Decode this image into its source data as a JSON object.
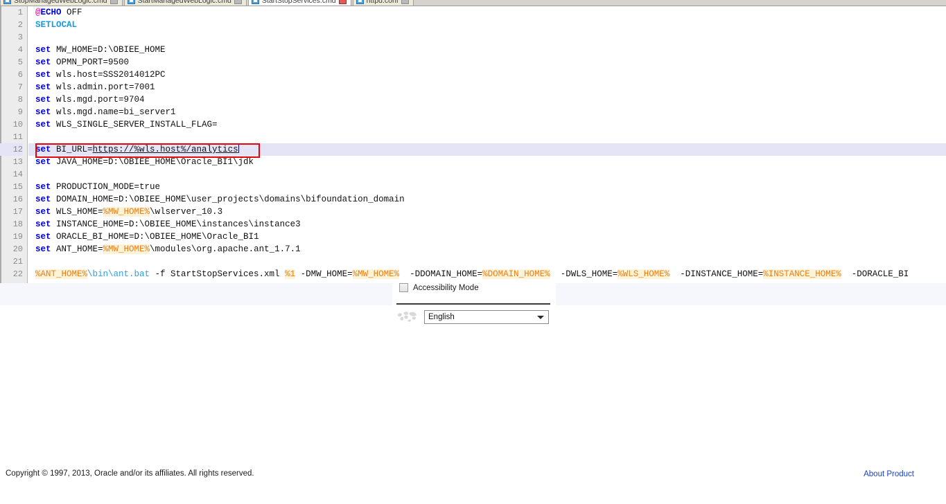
{
  "tabs": [
    {
      "label": "StopManagedWebLogic.cmd",
      "active": false
    },
    {
      "label": "StartManagedWebLogic.cmd",
      "active": false
    },
    {
      "label": "StartStopServices.cmd",
      "active": true
    },
    {
      "label": "httpd.conf",
      "active": false
    }
  ],
  "editor": {
    "highlighted_line": 12,
    "annotation_color": "#e8000a",
    "lines": [
      {
        "n": 1,
        "tokens": [
          {
            "t": "@",
            "c": "at"
          },
          {
            "t": "ECHO",
            "c": "kw"
          },
          {
            "t": " OFF",
            "c": ""
          }
        ]
      },
      {
        "n": 2,
        "tokens": [
          {
            "t": "SETLOCAL",
            "c": "kw2"
          }
        ]
      },
      {
        "n": 3,
        "tokens": []
      },
      {
        "n": 4,
        "tokens": [
          {
            "t": "set",
            "c": "kw"
          },
          {
            "t": " MW_HOME=D:\\OBIEE_HOME",
            "c": ""
          }
        ]
      },
      {
        "n": 5,
        "tokens": [
          {
            "t": "set",
            "c": "kw"
          },
          {
            "t": " OPMN_PORT=9500",
            "c": ""
          }
        ]
      },
      {
        "n": 6,
        "tokens": [
          {
            "t": "set",
            "c": "kw"
          },
          {
            "t": " wls.host=SSS2014012PC",
            "c": ""
          }
        ]
      },
      {
        "n": 7,
        "tokens": [
          {
            "t": "set",
            "c": "kw"
          },
          {
            "t": " wls.admin.port=7001",
            "c": ""
          }
        ]
      },
      {
        "n": 8,
        "tokens": [
          {
            "t": "set",
            "c": "kw"
          },
          {
            "t": " wls.mgd.port=9704",
            "c": ""
          }
        ]
      },
      {
        "n": 9,
        "tokens": [
          {
            "t": "set",
            "c": "kw"
          },
          {
            "t": " wls.mgd.name=bi_server1",
            "c": ""
          }
        ]
      },
      {
        "n": 10,
        "tokens": [
          {
            "t": "set",
            "c": "kw"
          },
          {
            "t": " WLS_SINGLE_SERVER_INSTALL_FLAG=",
            "c": ""
          }
        ]
      },
      {
        "n": 11,
        "tokens": []
      },
      {
        "n": 12,
        "tokens": [
          {
            "t": "set",
            "c": "kw"
          },
          {
            "t": " BI_URL=",
            "c": ""
          },
          {
            "t": "https://%wls.host%/analytics",
            "c": "url"
          },
          {
            "t": "",
            "c": "cursor"
          }
        ]
      },
      {
        "n": 13,
        "tokens": [
          {
            "t": "set",
            "c": "kw"
          },
          {
            "t": " JAVA_HOME=D:\\OBIEE_HOME\\Oracle_BI1\\jdk",
            "c": ""
          }
        ]
      },
      {
        "n": 14,
        "tokens": []
      },
      {
        "n": 15,
        "tokens": [
          {
            "t": "set",
            "c": "kw"
          },
          {
            "t": " PRODUCTION_MODE=true",
            "c": ""
          }
        ]
      },
      {
        "n": 16,
        "tokens": [
          {
            "t": "set",
            "c": "kw"
          },
          {
            "t": " DOMAIN_HOME=D:\\OBIEE_HOME\\user_projects\\domains\\bifoundation_domain",
            "c": ""
          }
        ]
      },
      {
        "n": 17,
        "tokens": [
          {
            "t": "set",
            "c": "kw"
          },
          {
            "t": " WLS_HOME=",
            "c": ""
          },
          {
            "t": "%MW_HOME%",
            "c": "var"
          },
          {
            "t": "\\wlserver_10.3",
            "c": ""
          }
        ]
      },
      {
        "n": 18,
        "tokens": [
          {
            "t": "set",
            "c": "kw"
          },
          {
            "t": " INSTANCE_HOME=D:\\OBIEE_HOME\\instances\\instance3",
            "c": ""
          }
        ]
      },
      {
        "n": 19,
        "tokens": [
          {
            "t": "set",
            "c": "kw"
          },
          {
            "t": " ORACLE_BI_HOME=D:\\OBIEE_HOME\\Oracle_BI1",
            "c": ""
          }
        ]
      },
      {
        "n": 20,
        "tokens": [
          {
            "t": "set",
            "c": "kw"
          },
          {
            "t": " ANT_HOME=",
            "c": ""
          },
          {
            "t": "%MW_HOME%",
            "c": "var"
          },
          {
            "t": "\\modules\\org.apache.ant_1.7.1",
            "c": ""
          }
        ]
      },
      {
        "n": 21,
        "tokens": []
      },
      {
        "n": 22,
        "tokens": [
          {
            "t": "%ANT_HOME%",
            "c": "var"
          },
          {
            "t": "\\bin\\ant.bat",
            "c": "path"
          },
          {
            "t": " -f StartStopServices.xml ",
            "c": ""
          },
          {
            "t": "%1",
            "c": "var"
          },
          {
            "t": " -DMW_HOME=",
            "c": ""
          },
          {
            "t": "%MW_HOME%",
            "c": "var"
          },
          {
            "t": "  -DDOMAIN_HOME=",
            "c": ""
          },
          {
            "t": "%DOMAIN_HOME%",
            "c": "var"
          },
          {
            "t": "  -DWLS_HOME=",
            "c": ""
          },
          {
            "t": "%WLS_HOME%",
            "c": "var"
          },
          {
            "t": "  -DINSTANCE_HOME=",
            "c": ""
          },
          {
            "t": "%INSTANCE_HOME%",
            "c": "var"
          },
          {
            "t": "  -DORACLE_BI",
            "c": ""
          }
        ]
      }
    ]
  },
  "accessibility": {
    "checkbox_label": "Accessibility Mode",
    "checked": false
  },
  "language": {
    "icon": "globe-icon",
    "selected": "English",
    "options": [
      "English"
    ]
  },
  "footer": {
    "copyright": "Copyright © 1997, 2013, Oracle and/or its affiliates. All rights reserved.",
    "about_link": "About Product",
    "link_color": "#1c3fbe"
  }
}
